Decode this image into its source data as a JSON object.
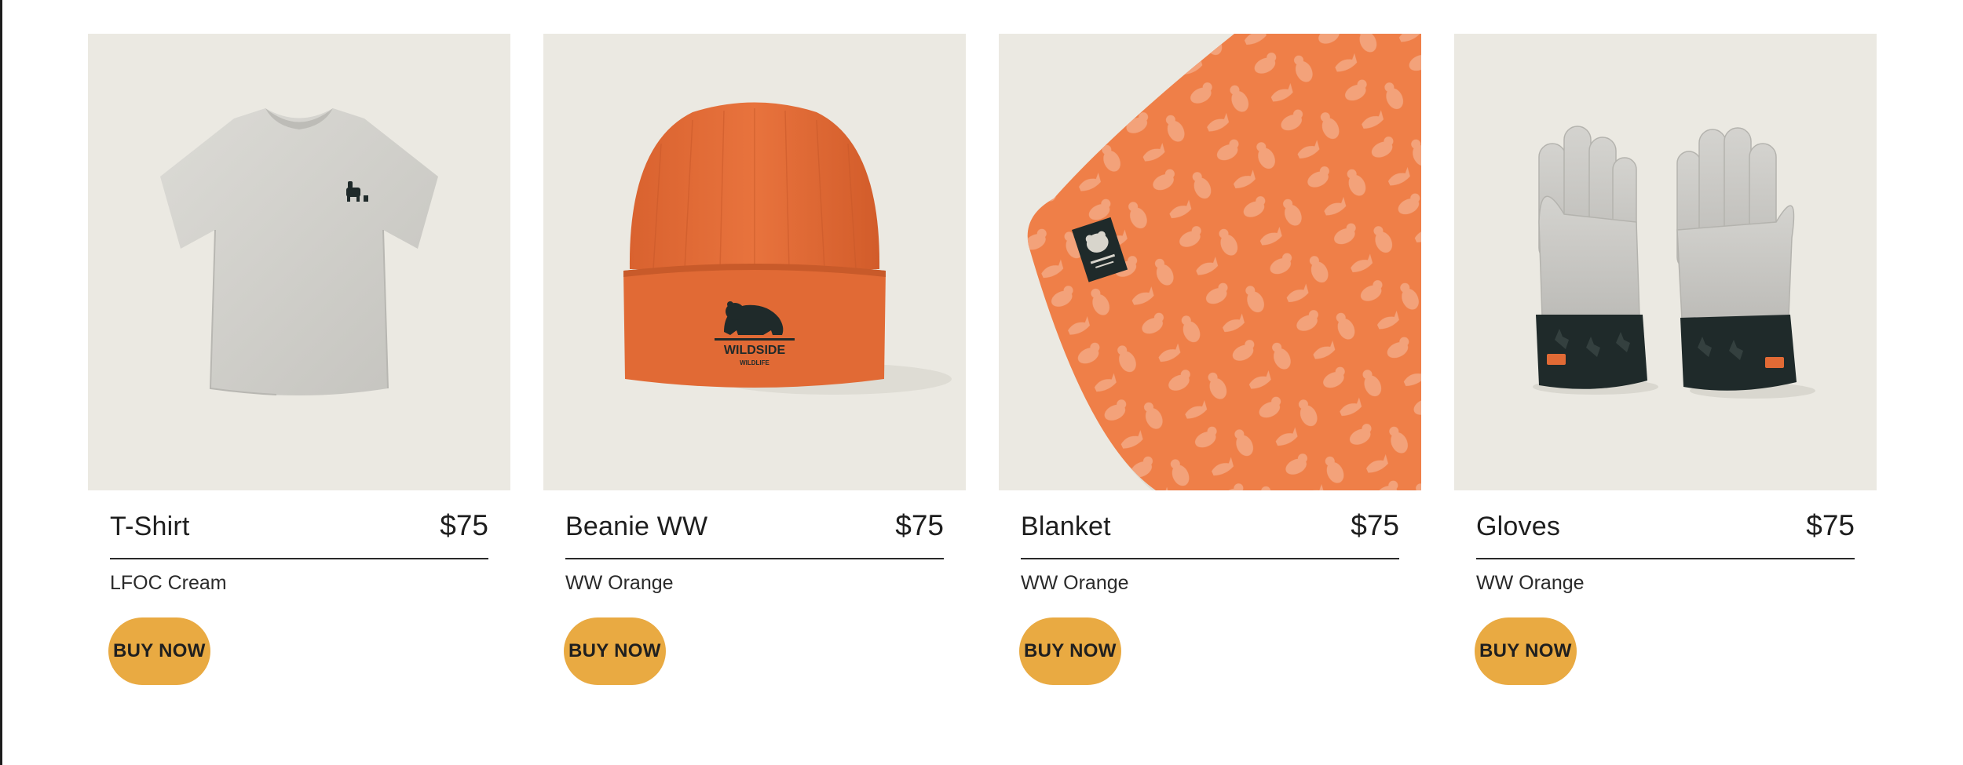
{
  "products": [
    {
      "name": "T-Shirt",
      "price": "$75",
      "variant": "LFOC Cream",
      "button_label": "BUY NOW",
      "image_icon": "tshirt-image",
      "color": "#d4d3ce"
    },
    {
      "name": "Beanie WW",
      "price": "$75",
      "variant": "WW Orange",
      "button_label": "BUY NOW",
      "image_icon": "beanie-image",
      "color": "#e16a35",
      "logo_text": "WILDSIDE",
      "logo_subtext": "WILDLIFE"
    },
    {
      "name": "Blanket",
      "price": "$75",
      "variant": "WW Orange",
      "button_label": "BUY NOW",
      "image_icon": "blanket-image",
      "color": "#ef7f48"
    },
    {
      "name": "Gloves",
      "price": "$75",
      "variant": "WW Orange",
      "button_label": "BUY NOW",
      "image_icon": "gloves-image",
      "color": "#c9c8c4"
    }
  ],
  "colors": {
    "image_bg": "#ebe9e2",
    "button": "#e9aa42",
    "divider": "#2a2a2a"
  }
}
